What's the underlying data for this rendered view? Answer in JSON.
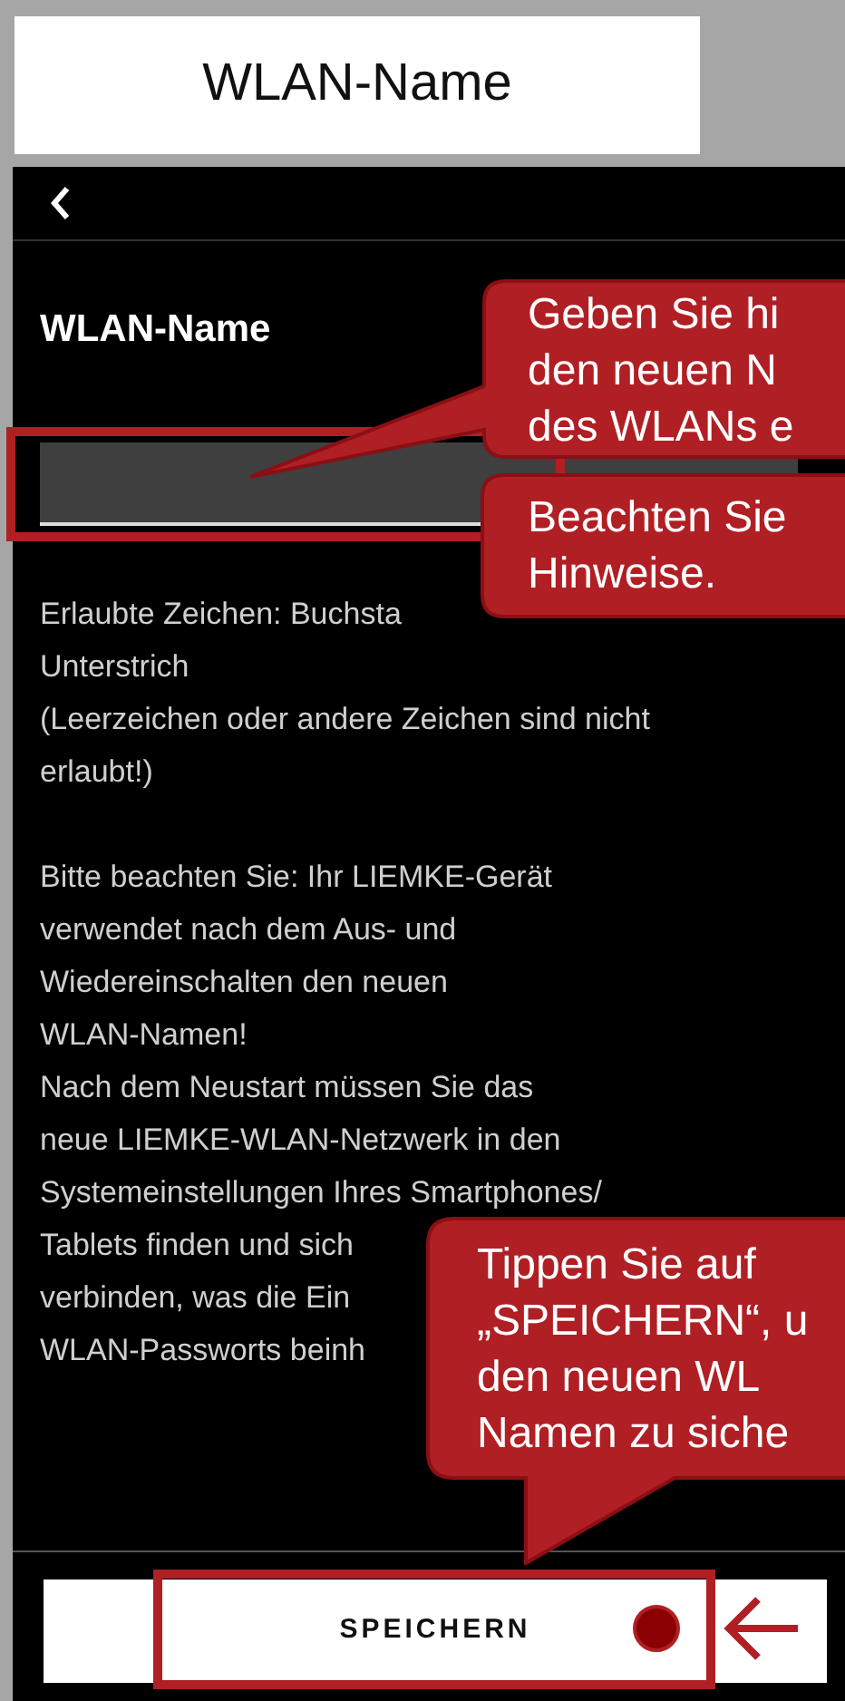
{
  "caption": "WLAN-Name",
  "page_title": "WLAN-Name",
  "hint_paragraphs": [
    {
      "lines": [
        "Erlaubte Zeichen: Buchsta",
        "Unterstrich",
        "(Leerzeichen oder andere Zeichen sind nicht",
        "erlaubt!)"
      ]
    },
    {
      "lines": [
        "Bitte beachten Sie: Ihr LIEMKE-Gerät",
        "verwendet nach dem Aus- und",
        "Wiedereinschalten den neuen",
        "WLAN-Namen!",
        "Nach dem Neustart müssen Sie das",
        "neue LIEMKE-WLAN-Netzwerk in den",
        "Systemeinstellungen Ihres Smartphones/",
        "Tablets finden und sich",
        "verbinden, was die Ein",
        "WLAN-Passworts beinh"
      ]
    }
  ],
  "save_button": "SPEICHERN",
  "callouts": [
    {
      "lines": [
        "Geben Sie hi",
        "den neuen N",
        "des WLANs e"
      ]
    },
    {
      "lines": [
        "Beachten Sie",
        "Hinweise."
      ]
    },
    {
      "lines": [
        "Tippen Sie auf",
        "„SPEICHERN“, u",
        "den neuen WL",
        "Namen zu siche"
      ]
    }
  ]
}
